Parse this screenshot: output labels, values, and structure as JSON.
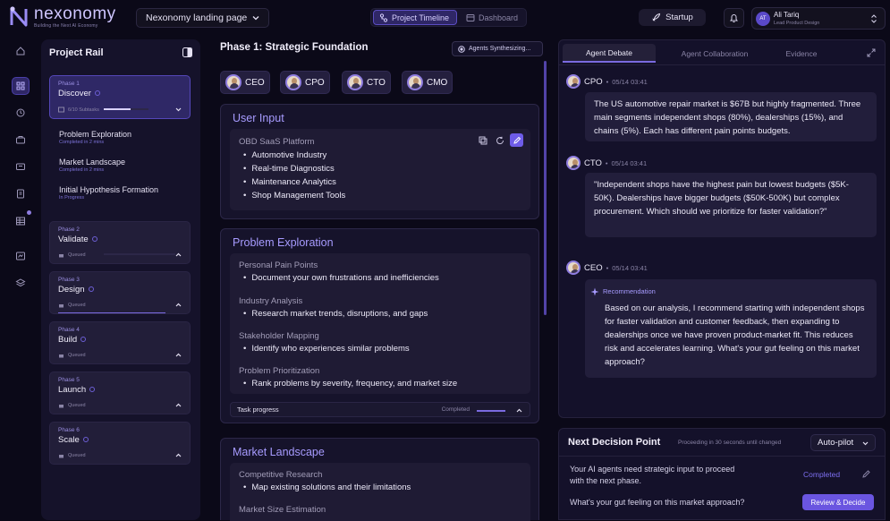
{
  "brand": {
    "name": "nexonomy",
    "tagline": "Building the Next AI Economy"
  },
  "header": {
    "project_select": "Nexonomy landing page",
    "view_tabs": [
      {
        "label": "Project Timeline",
        "active": true
      },
      {
        "label": "Dashboard",
        "active": false
      }
    ],
    "stage_button": "Startup",
    "user": {
      "initials": "AT",
      "name": "Ali Tariq",
      "role": "Lead Product Design"
    }
  },
  "rail": {
    "title": "Project Rail",
    "phases": [
      {
        "label": "Phase 1",
        "name": "Discover",
        "status": "6/10 Subtasks"
      },
      {
        "label": "Phase 2",
        "name": "Validate",
        "status": "Queued"
      },
      {
        "label": "Phase 3",
        "name": "Design",
        "status": "Queued"
      },
      {
        "label": "Phase 4",
        "name": "Build",
        "status": "Queued"
      },
      {
        "label": "Phase 5",
        "name": "Launch",
        "status": "Queued"
      },
      {
        "label": "Phase 6",
        "name": "Scale",
        "status": "Queued"
      }
    ],
    "phase1_progress": 0.6,
    "subtasks": [
      {
        "name": "Problem Exploration",
        "status": "Completed in 2 mins"
      },
      {
        "name": "Market Landscape",
        "status": "Completed in 2 mins"
      },
      {
        "name": "Initial Hypothesis Formation",
        "status": "In Progress"
      }
    ]
  },
  "main": {
    "phase_title": "Phase 1: Strategic Foundation",
    "synth_badge": "Agents Synthesizing...",
    "agents": [
      "CEO",
      "CPO",
      "CTO",
      "CMO"
    ],
    "user_input": {
      "title": "User Input",
      "heading": "OBD SaaS Platform",
      "items": [
        "Automotive Industry",
        "Real-time Diagnostics",
        "Maintenance Analytics",
        "Shop Management Tools"
      ]
    },
    "problem": {
      "title": "Problem Exploration",
      "sections": [
        {
          "title": "Personal Pain Points",
          "item": "Document your own frustrations and inefficiencies"
        },
        {
          "title": "Industry Analysis",
          "item": "Research market trends, disruptions, and gaps"
        },
        {
          "title": "Stakeholder Mapping",
          "item": "Identify who experiences similar problems"
        },
        {
          "title": "Problem Prioritization",
          "item": "Rank problems by severity, frequency, and market size"
        }
      ],
      "task_progress_label": "Task progress",
      "task_progress_status": "Completed"
    },
    "market": {
      "title": "Market Landscape",
      "sections": [
        {
          "title": "Competitive Research",
          "item": "Map existing solutions and their limitations"
        },
        {
          "title": "Market Size Estimation",
          "item": ""
        }
      ]
    }
  },
  "debate": {
    "tabs": [
      "Agent Debate",
      "Agent Collaboration",
      "Evidence"
    ],
    "messages": [
      {
        "role": "CPO",
        "time": "05/14 03:41",
        "text": "The US automotive repair market is $67B but highly fragmented. Three main segments independent shops (80%), dealerships (15%), and chains (5%). Each has different pain points budgets."
      },
      {
        "role": "CTO",
        "time": "05/14 03:41",
        "text": "\"Independent shops have the highest pain but lowest budgets ($5K-50K). Dealerships have bigger budgets ($50K-500K) but complex procurement. Which should we prioritize for faster validation?\""
      },
      {
        "role": "CEO",
        "time": "05/14 03:41",
        "label": "Recommendation",
        "text": "Based on our analysis, I recommend starting with independent shops for faster validation and customer feedback, then expanding to dealerships once we have proven product-market fit. This reduces risk and accelerates learning. What's your gut feeling on this market approach?"
      }
    ]
  },
  "decision": {
    "title": "Next Decision Point",
    "note": "Proceeding in 30 seconds until changed",
    "mode": "Auto-pilot",
    "line1": "Your AI agents need strategic input to proceed",
    "line2": "with the next phase.",
    "completed": "Completed",
    "question": "What's your gut feeling on this market approach?",
    "button": "Review & Decide"
  },
  "colors": {
    "accent": "#7a6ae0",
    "bg": "#0b0918",
    "panel": "#15122a"
  }
}
